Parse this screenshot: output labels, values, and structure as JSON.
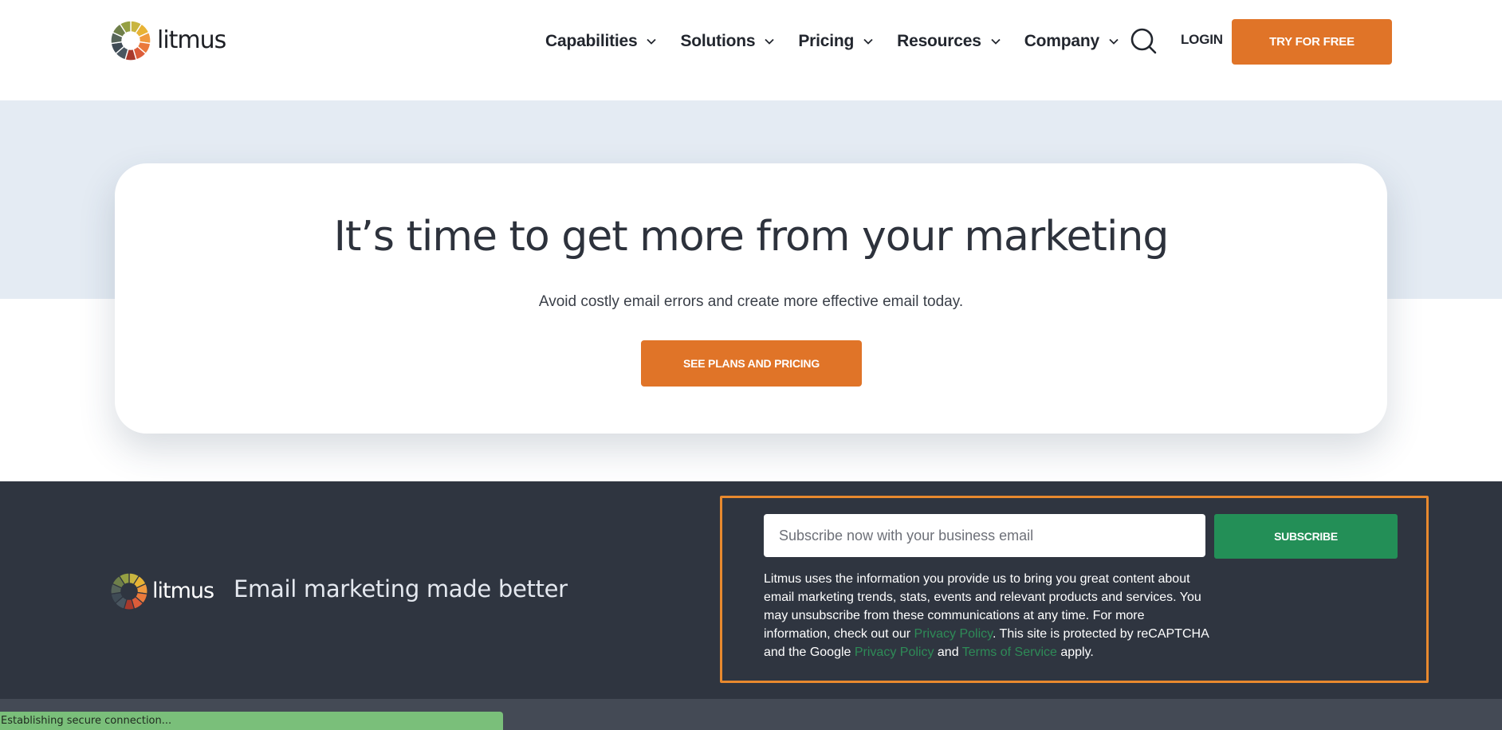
{
  "brand": {
    "name": "litmus",
    "accent_color": "#e07428",
    "logo_segment_colors": [
      "#c9b540",
      "#e8b335",
      "#f09a3e",
      "#ea7a3c",
      "#dc5d3a",
      "#a83a2c",
      "#4a5660",
      "#3f4b55",
      "#56645a",
      "#6f7f4a",
      "#95a043"
    ]
  },
  "header": {
    "nav": [
      {
        "label": "Capabilities",
        "icon": "chevron-down-icon"
      },
      {
        "label": "Solutions",
        "icon": "chevron-down-icon"
      },
      {
        "label": "Pricing",
        "icon": "chevron-down-icon"
      },
      {
        "label": "Resources",
        "icon": "chevron-down-icon"
      },
      {
        "label": "Company",
        "icon": "chevron-down-icon"
      }
    ],
    "search_icon": "search-icon",
    "login_label": "LOGIN",
    "cta_label": "TRY FOR FREE"
  },
  "hero": {
    "title": "It’s time to get more from your marketing",
    "subtitle": "Avoid costly email errors and create more effective email today.",
    "button_label": "SEE PLANS AND PRICING"
  },
  "footer": {
    "brand_name": "litmus",
    "tagline": "Email marketing made better",
    "subscribe": {
      "placeholder": "Subscribe now with your business email",
      "value": "",
      "button_label": "SUBSCRIBE",
      "button_color": "#238f57",
      "legal": {
        "part1": "Litmus uses the information you provide us to bring you great content about email marketing trends, stats, events and relevant products and services. You may unsubscribe from these communications at any time. For more information, check out our ",
        "link1": "Privacy Policy",
        "part2": ". This site is protected by reCAPTCHA and the Google ",
        "link2": "Privacy Policy",
        "part3": " and ",
        "link3": "Terms of Service",
        "part4": " apply."
      }
    }
  },
  "status_bar": {
    "text": "Establishing secure connection..."
  }
}
